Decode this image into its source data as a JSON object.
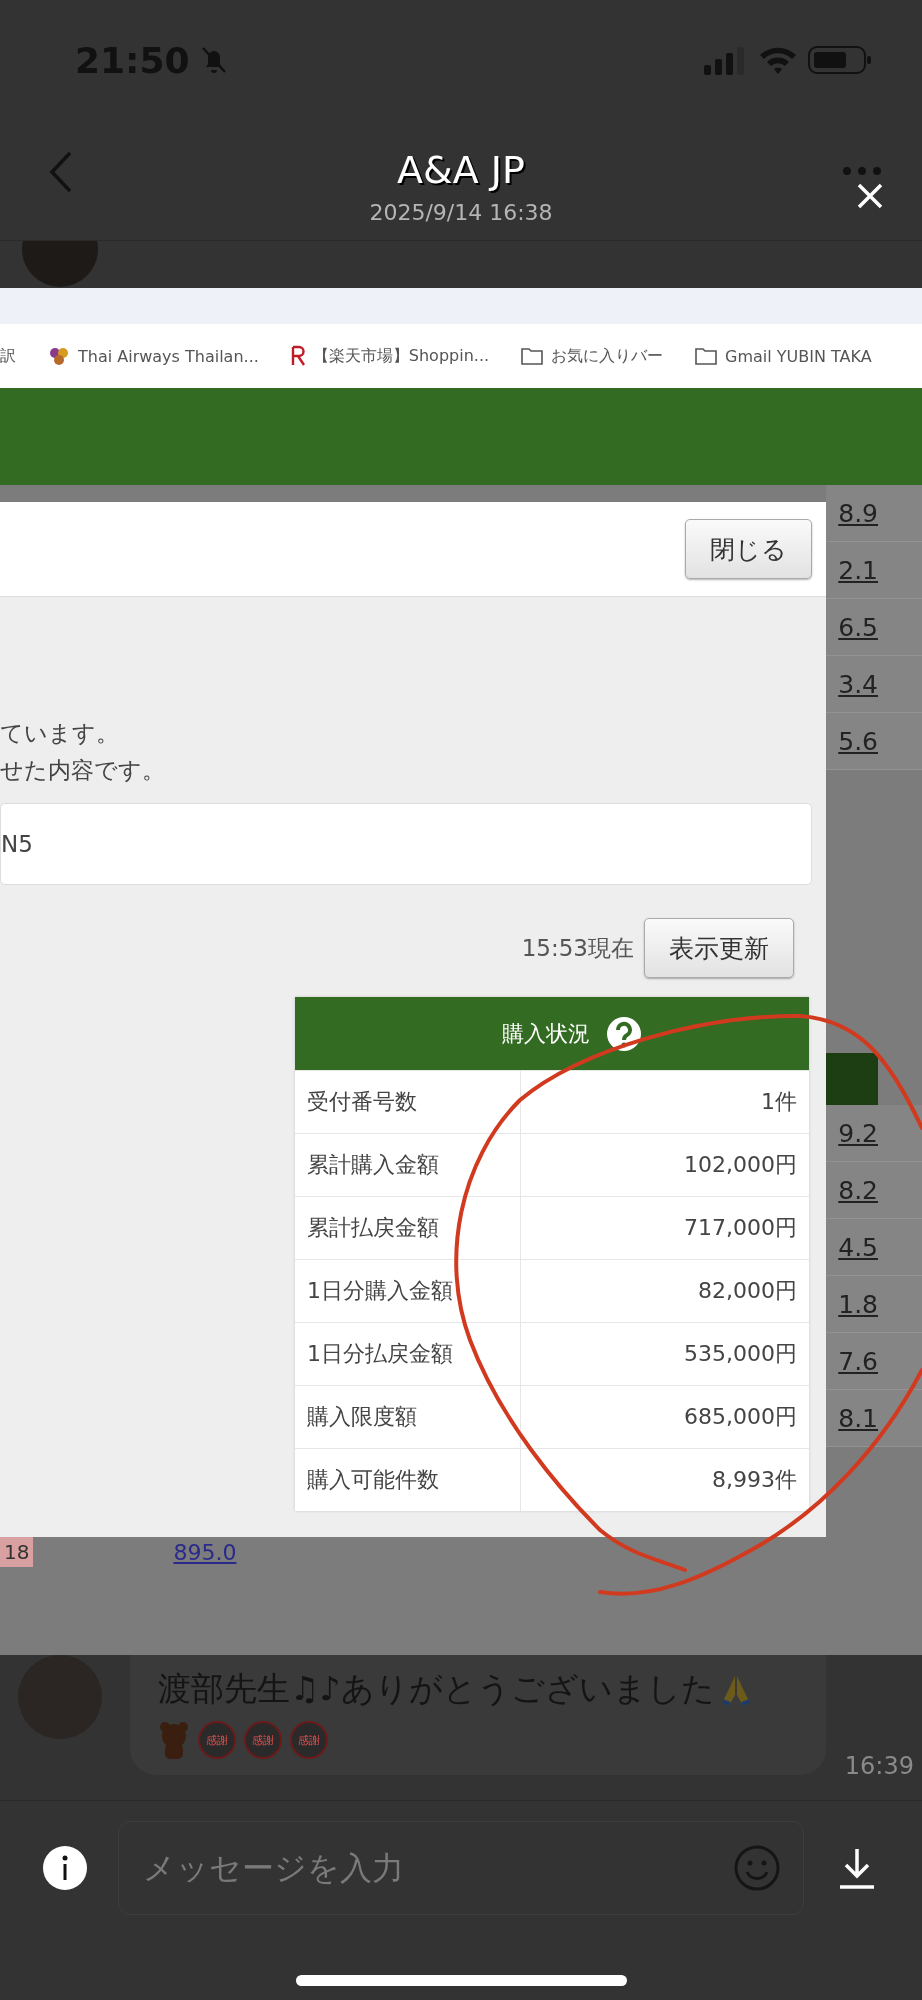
{
  "status_bar": {
    "time": "21:50"
  },
  "header": {
    "title": "A&A JP",
    "subtitle": "2025/9/14 16:38"
  },
  "screenshot": {
    "bookmarks": [
      {
        "kind": "text",
        "label": "訳"
      },
      {
        "kind": "site",
        "label": "Thai Airways Thailan..."
      },
      {
        "kind": "rakuten",
        "label": "【楽天市場】Shoppin..."
      },
      {
        "kind": "folder",
        "label": "お気に入りバー"
      },
      {
        "kind": "folder",
        "label": "Gmail YUBIN TAKA"
      }
    ],
    "background_column": {
      "upper": [
        "8.9",
        "2.1",
        "6.5",
        "3.4",
        "5.6"
      ],
      "lower": [
        "9.2",
        "8.2",
        "4.5",
        "1.8",
        "7.6",
        "8.1"
      ]
    },
    "background_row": {
      "badge": "18",
      "value": "895.0"
    },
    "dialog": {
      "close_button": "閉じる",
      "message_lines": [
        "ています。",
        "せた内容です。"
      ],
      "field_value": "N5",
      "timestamp": "15:53現在",
      "refresh_button": "表示更新",
      "table": {
        "title": "購入状況",
        "rows": [
          {
            "label": "受付番号数",
            "value": "1件"
          },
          {
            "label": "累計購入金額",
            "value": "102,000円"
          },
          {
            "label": "累計払戻金額",
            "value": "717,000円"
          },
          {
            "label": "1日分購入金額",
            "value": "82,000円"
          },
          {
            "label": "1日分払戻金額",
            "value": "535,000円"
          },
          {
            "label": "購入限度額",
            "value": "685,000円"
          },
          {
            "label": "購入可能件数",
            "value": "8,993件"
          }
        ]
      }
    }
  },
  "chat": {
    "message": "渡部先生♫♪ありがとうございました",
    "stamps": [
      "感謝",
      "感謝",
      "感謝"
    ],
    "time": "16:39"
  },
  "composer": {
    "placeholder": "メッセージを入力"
  }
}
